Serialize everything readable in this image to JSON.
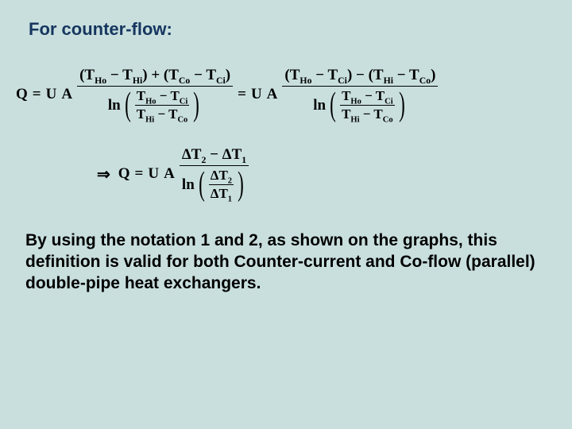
{
  "heading": "For counter-flow:",
  "sym": {
    "Q": "Q",
    "eq": "=",
    "U": "U",
    "A": "A",
    "ln": "ln",
    "implies": "⇒",
    "minus": "−",
    "plus": "+",
    "DT2": "ΔT",
    "DT1": "ΔT",
    "THo": "T",
    "THoSub": "Ho",
    "THi": "T",
    "THiSub": "Hi",
    "TCo": "T",
    "TCoSub": "Co",
    "TCi": "T",
    "TCiSub": "Ci",
    "sub2": "2",
    "sub1": "1"
  },
  "body": "By using the notation 1 and 2, as shown on the graphs, this definition is valid for both Counter-current and Co-flow (parallel) double-pipe heat exchangers."
}
